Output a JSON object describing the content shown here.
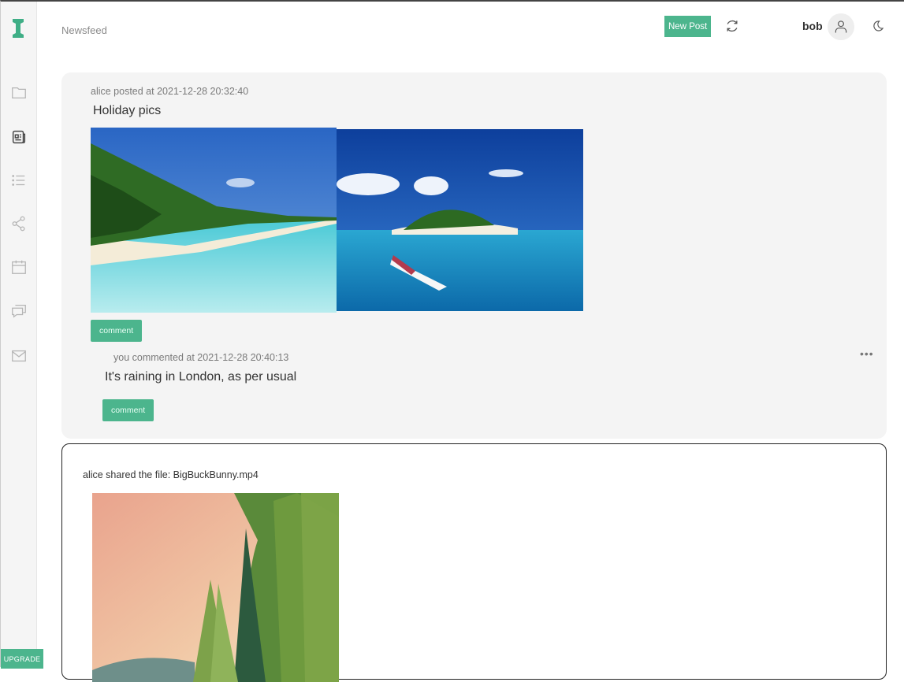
{
  "header": {
    "title": "Newsfeed",
    "new_post_label": "New Post",
    "user_name": "bob"
  },
  "sidebar": {
    "items": [
      {
        "icon": "folder-icon"
      },
      {
        "icon": "newsfeed-icon",
        "active": true
      },
      {
        "icon": "list-icon"
      },
      {
        "icon": "share-icon"
      },
      {
        "icon": "calendar-icon"
      },
      {
        "icon": "chat-icon"
      },
      {
        "icon": "mail-icon"
      }
    ],
    "upgrade_label": "UPGRADE"
  },
  "post": {
    "meta": "alice posted at 2021-12-28 20:32:40",
    "text": "Holiday pics",
    "images": [
      "beach-photo",
      "island-photo"
    ],
    "comment_label": "comment",
    "comments": [
      {
        "meta": "you commented at 2021-12-28 20:40:13",
        "text": "It's raining in London, as per usual",
        "comment_label": "comment"
      }
    ],
    "more_label": "•••"
  },
  "share": {
    "text": "alice shared the file: BigBuckBunny.mp4",
    "thumbnail": "video-thumbnail"
  },
  "colors": {
    "accent": "#4cb58d",
    "sidebar_bg": "#f5f5f5",
    "card_bg": "#f4f4f4"
  }
}
